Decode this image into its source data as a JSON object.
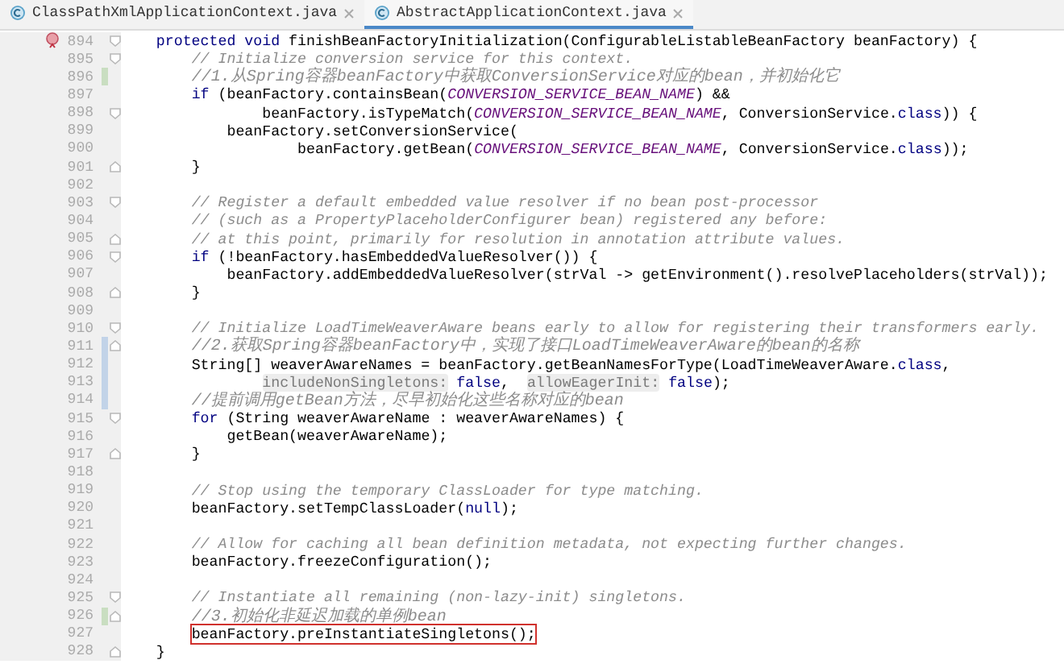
{
  "tabs": [
    {
      "label": "ClassPathXmlApplicationContext.java",
      "selected": false
    },
    {
      "label": "AbstractApplicationContext.java",
      "selected": true
    }
  ],
  "lines": [
    {
      "number": "894",
      "overridden": true,
      "fold_start": true,
      "fold_end": false,
      "added": false,
      "modified": false,
      "highlighted": false,
      "tokens": [
        {
          "kind": "keyword",
          "text": "    protected void "
        },
        {
          "kind": "plain",
          "text": "finishBeanFactoryInitialization(ConfigurableListableBeanFactory beanFactory) {"
        }
      ]
    },
    {
      "number": "895",
      "overridden": false,
      "fold_start": true,
      "fold_end": false,
      "added": false,
      "modified": false,
      "highlighted": false,
      "tokens": [
        {
          "kind": "comment",
          "text": "        // Initialize conversion service for this context."
        }
      ]
    },
    {
      "number": "896",
      "overridden": false,
      "fold_start": false,
      "fold_end": false,
      "added": true,
      "modified": false,
      "highlighted": false,
      "tokens": [
        {
          "kind": "comment",
          "text": "        //1.从Spring容器beanFactory中获取ConversionService对应的bean，并初始化它"
        }
      ]
    },
    {
      "number": "897",
      "overridden": false,
      "fold_start": false,
      "fold_end": false,
      "added": false,
      "modified": false,
      "highlighted": false,
      "tokens": [
        {
          "kind": "keyword",
          "text": "        if"
        },
        {
          "kind": "plain",
          "text": " (beanFactory.containsBean("
        },
        {
          "kind": "constant",
          "text": "CONVERSION_SERVICE_BEAN_NAME"
        },
        {
          "kind": "plain",
          "text": ") &&"
        }
      ]
    },
    {
      "number": "898",
      "overridden": false,
      "fold_start": true,
      "fold_end": false,
      "added": false,
      "modified": false,
      "highlighted": false,
      "tokens": [
        {
          "kind": "plain",
          "text": "                beanFactory.isTypeMatch("
        },
        {
          "kind": "constant",
          "text": "CONVERSION_SERVICE_BEAN_NAME"
        },
        {
          "kind": "plain",
          "text": ", ConversionService."
        },
        {
          "kind": "keyword",
          "text": "class"
        },
        {
          "kind": "plain",
          "text": ")) {"
        }
      ]
    },
    {
      "number": "899",
      "overridden": false,
      "fold_start": false,
      "fold_end": false,
      "added": false,
      "modified": false,
      "highlighted": false,
      "tokens": [
        {
          "kind": "plain",
          "text": "            beanFactory.setConversionService("
        }
      ]
    },
    {
      "number": "900",
      "overridden": false,
      "fold_start": false,
      "fold_end": false,
      "added": false,
      "modified": false,
      "highlighted": false,
      "tokens": [
        {
          "kind": "plain",
          "text": "                    beanFactory.getBean("
        },
        {
          "kind": "constant",
          "text": "CONVERSION_SERVICE_BEAN_NAME"
        },
        {
          "kind": "plain",
          "text": ", ConversionService."
        },
        {
          "kind": "keyword",
          "text": "class"
        },
        {
          "kind": "plain",
          "text": "));"
        }
      ]
    },
    {
      "number": "901",
      "overridden": false,
      "fold_start": false,
      "fold_end": true,
      "added": false,
      "modified": false,
      "highlighted": false,
      "tokens": [
        {
          "kind": "plain",
          "text": "        }"
        }
      ]
    },
    {
      "number": "902",
      "overridden": false,
      "fold_start": false,
      "fold_end": false,
      "added": false,
      "modified": false,
      "highlighted": false
    },
    {
      "number": "903",
      "overridden": false,
      "fold_start": true,
      "fold_end": false,
      "added": false,
      "modified": false,
      "highlighted": false,
      "tokens": [
        {
          "kind": "comment",
          "text": "        // Register a default embedded value resolver if no bean post-processor"
        }
      ]
    },
    {
      "number": "904",
      "overridden": false,
      "fold_start": false,
      "fold_end": false,
      "added": false,
      "modified": false,
      "highlighted": false,
      "tokens": [
        {
          "kind": "comment",
          "text": "        // (such as a PropertyPlaceholderConfigurer bean) registered any before:"
        }
      ]
    },
    {
      "number": "905",
      "overridden": false,
      "fold_start": false,
      "fold_end": true,
      "added": false,
      "modified": false,
      "highlighted": false,
      "tokens": [
        {
          "kind": "comment",
          "text": "        // at this point, primarily for resolution in annotation attribute values."
        }
      ]
    },
    {
      "number": "906",
      "overridden": false,
      "fold_start": true,
      "fold_end": false,
      "added": false,
      "modified": false,
      "highlighted": false,
      "tokens": [
        {
          "kind": "keyword",
          "text": "        if"
        },
        {
          "kind": "plain",
          "text": " (!beanFactory.hasEmbeddedValueResolver()) {"
        }
      ]
    },
    {
      "number": "907",
      "overridden": false,
      "fold_start": false,
      "fold_end": false,
      "added": false,
      "modified": false,
      "highlighted": false,
      "tokens": [
        {
          "kind": "plain",
          "text": "            beanFactory.addEmbeddedValueResolver(strVal -> getEnvironment().resolvePlaceholders(strVal));"
        }
      ]
    },
    {
      "number": "908",
      "overridden": false,
      "fold_start": false,
      "fold_end": true,
      "added": false,
      "modified": false,
      "highlighted": false,
      "tokens": [
        {
          "kind": "plain",
          "text": "        }"
        }
      ]
    },
    {
      "number": "909",
      "overridden": false,
      "fold_start": false,
      "fold_end": false,
      "added": false,
      "modified": false,
      "highlighted": false
    },
    {
      "number": "910",
      "overridden": false,
      "fold_start": true,
      "fold_end": false,
      "added": false,
      "modified": false,
      "highlighted": false,
      "tokens": [
        {
          "kind": "comment",
          "text": "        // Initialize LoadTimeWeaverAware beans early to allow for registering their transformers early."
        }
      ]
    },
    {
      "number": "911",
      "overridden": false,
      "fold_start": false,
      "fold_end": true,
      "added": false,
      "modified": true,
      "highlighted": false,
      "tokens": [
        {
          "kind": "comment",
          "text": "        //2.获取Spring容器beanFactory中，实现了接口LoadTimeWeaverAware的bean的名称"
        }
      ]
    },
    {
      "number": "912",
      "overridden": false,
      "fold_start": false,
      "fold_end": false,
      "added": false,
      "modified": true,
      "highlighted": false,
      "tokens": [
        {
          "kind": "plain",
          "text": "        String[] weaverAwareNames = beanFactory.getBeanNamesForType(LoadTimeWeaverAware."
        },
        {
          "kind": "keyword",
          "text": "class"
        },
        {
          "kind": "plain",
          "text": ","
        }
      ]
    },
    {
      "number": "913",
      "overridden": false,
      "fold_start": false,
      "fold_end": false,
      "added": false,
      "modified": true,
      "highlighted": false,
      "tokens": [
        {
          "kind": "hint",
          "text": "                includeNonSingletons:"
        },
        {
          "kind": "keyword",
          "text": " false"
        },
        {
          "kind": "plain",
          "text": ",  "
        },
        {
          "kind": "hint",
          "text": "allowEagerInit:"
        },
        {
          "kind": "keyword",
          "text": " false"
        },
        {
          "kind": "plain",
          "text": ");"
        }
      ]
    },
    {
      "number": "914",
      "overridden": false,
      "fold_start": false,
      "fold_end": false,
      "added": false,
      "modified": true,
      "highlighted": false,
      "tokens": [
        {
          "kind": "comment",
          "text": "        //提前调用getBean方法，尽早初始化这些名称对应的bean"
        }
      ]
    },
    {
      "number": "915",
      "overridden": false,
      "fold_start": true,
      "fold_end": false,
      "added": false,
      "modified": false,
      "highlighted": false,
      "tokens": [
        {
          "kind": "keyword",
          "text": "        for"
        },
        {
          "kind": "plain",
          "text": " (String weaverAwareName : weaverAwareNames) {"
        }
      ]
    },
    {
      "number": "916",
      "overridden": false,
      "fold_start": false,
      "fold_end": false,
      "added": false,
      "modified": false,
      "highlighted": false,
      "tokens": [
        {
          "kind": "plain",
          "text": "            getBean(weaverAwareName);"
        }
      ]
    },
    {
      "number": "917",
      "overridden": false,
      "fold_start": false,
      "fold_end": true,
      "added": false,
      "modified": false,
      "highlighted": false,
      "tokens": [
        {
          "kind": "plain",
          "text": "        }"
        }
      ]
    },
    {
      "number": "918",
      "overridden": false,
      "fold_start": false,
      "fold_end": false,
      "added": false,
      "modified": false,
      "highlighted": false
    },
    {
      "number": "919",
      "overridden": false,
      "fold_start": false,
      "fold_end": false,
      "added": false,
      "modified": false,
      "highlighted": false,
      "tokens": [
        {
          "kind": "comment",
          "text": "        // Stop using the temporary ClassLoader for type matching."
        }
      ]
    },
    {
      "number": "920",
      "overridden": false,
      "fold_start": false,
      "fold_end": false,
      "added": false,
      "modified": false,
      "highlighted": false,
      "tokens": [
        {
          "kind": "plain",
          "text": "        beanFactory.setTempClassLoader("
        },
        {
          "kind": "keyword",
          "text": "null"
        },
        {
          "kind": "plain",
          "text": ");"
        }
      ]
    },
    {
      "number": "921",
      "overridden": false,
      "fold_start": false,
      "fold_end": false,
      "added": false,
      "modified": false,
      "highlighted": false
    },
    {
      "number": "922",
      "overridden": false,
      "fold_start": false,
      "fold_end": false,
      "added": false,
      "modified": false,
      "highlighted": false,
      "tokens": [
        {
          "kind": "comment",
          "text": "        // Allow for caching all bean definition metadata, not expecting further changes."
        }
      ]
    },
    {
      "number": "923",
      "overridden": false,
      "fold_start": false,
      "fold_end": false,
      "added": false,
      "modified": false,
      "highlighted": false,
      "tokens": [
        {
          "kind": "plain",
          "text": "        beanFactory.freezeConfiguration();"
        }
      ]
    },
    {
      "number": "924",
      "overridden": false,
      "fold_start": false,
      "fold_end": false,
      "added": false,
      "modified": false,
      "highlighted": false
    },
    {
      "number": "925",
      "overridden": false,
      "fold_start": true,
      "fold_end": false,
      "added": false,
      "modified": false,
      "highlighted": false,
      "tokens": [
        {
          "kind": "comment",
          "text": "        // Instantiate all remaining (non-lazy-init) singletons."
        }
      ]
    },
    {
      "number": "926",
      "overridden": false,
      "fold_start": false,
      "fold_end": true,
      "added": true,
      "modified": false,
      "highlighted": false,
      "tokens": [
        {
          "kind": "comment",
          "text": "        //3.初始化非延迟加载的单例bean"
        }
      ]
    },
    {
      "number": "927",
      "overridden": false,
      "fold_start": false,
      "fold_end": false,
      "added": false,
      "modified": false,
      "highlighted": true,
      "tokens": [
        {
          "kind": "plain",
          "text": "        beanFactory.preInstantiateSingletons();"
        }
      ]
    },
    {
      "number": "928",
      "overridden": false,
      "fold_start": false,
      "fold_end": true,
      "added": false,
      "modified": false,
      "highlighted": false,
      "tokens": [
        {
          "kind": "plain",
          "text": "    }"
        }
      ]
    }
  ]
}
